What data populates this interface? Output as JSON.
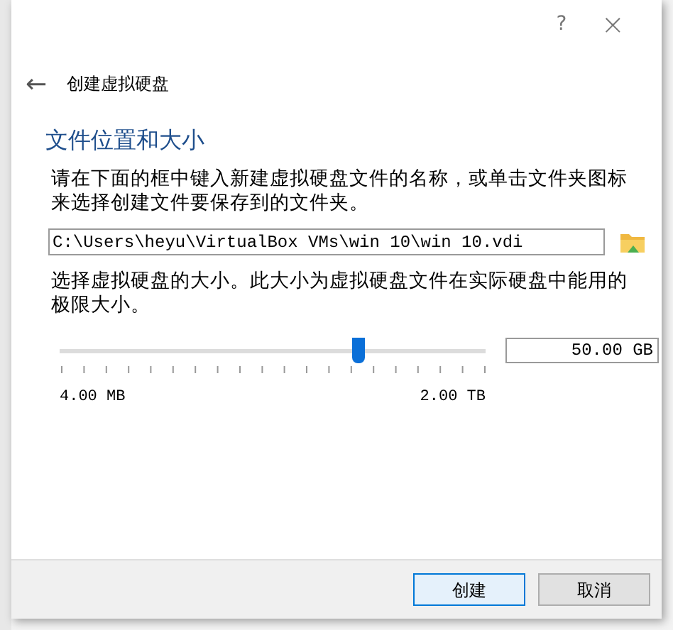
{
  "window": {
    "help": "?",
    "close": "×"
  },
  "header": {
    "back": "←",
    "title": "创建虚拟硬盘"
  },
  "section_title": "文件位置和大小",
  "instructions": "请在下面的框中键入新建虚拟硬盘文件的名称，或单击文件夹图标来选择创建文件要保存到的文件夹。",
  "file_path": {
    "value": "C:\\Users\\heyu\\VirtualBox VMs\\win 10\\win 10.vdi"
  },
  "size_hint": "选择虚拟硬盘的大小。此大小为虚拟硬盘文件在实际硬盘中能用的极限大小。",
  "size_slider": {
    "level": 0.7,
    "value": "50.00 GB",
    "min_label": "4.00 MB",
    "max_label": "2.00 TB"
  },
  "buttons": [
    {
      "label": "创建",
      "selected": true
    },
    {
      "label": "取消",
      "selected": false
    }
  ]
}
